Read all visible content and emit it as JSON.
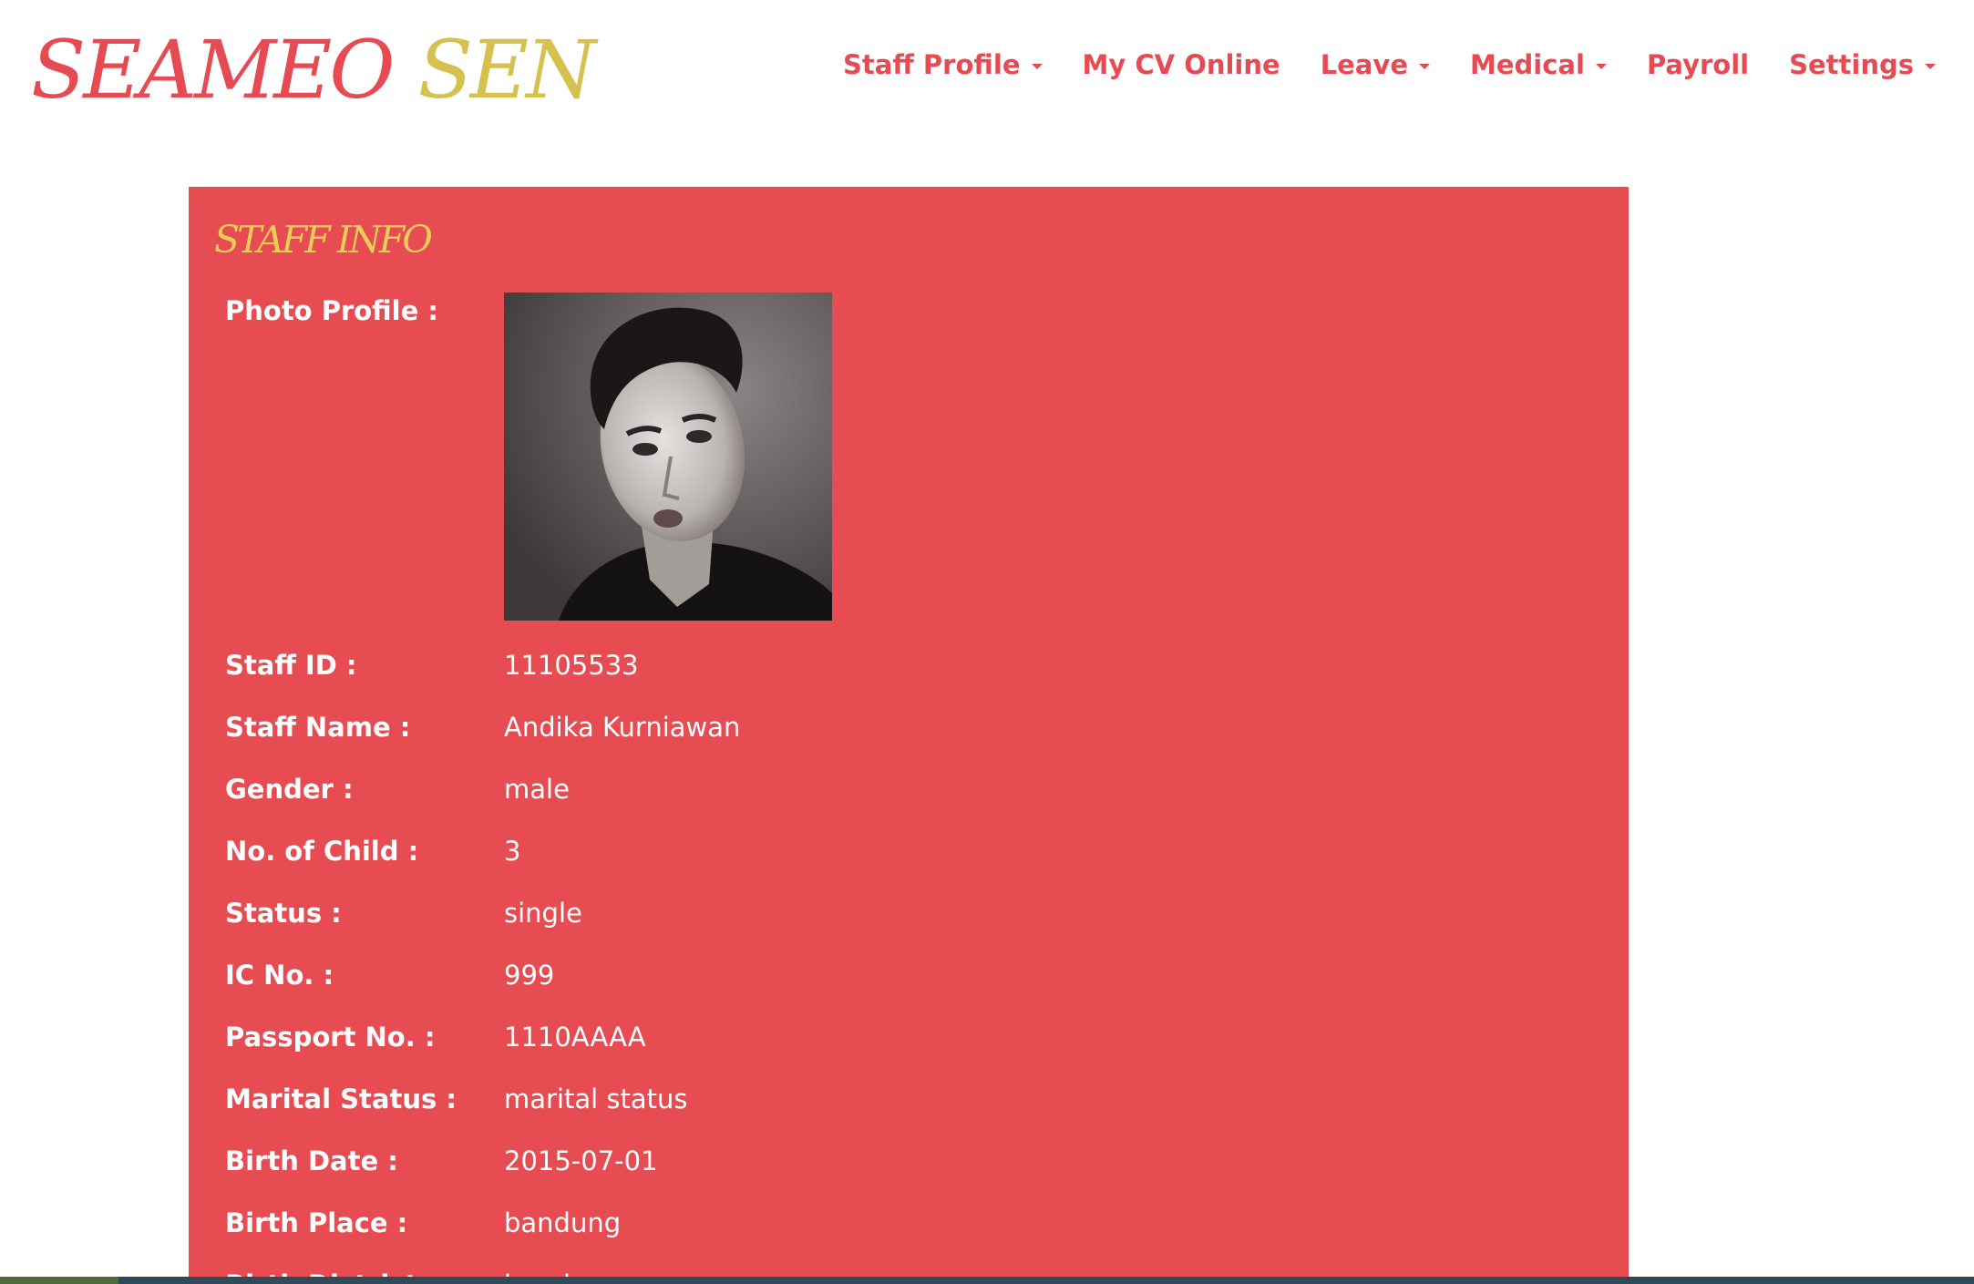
{
  "header": {
    "logo_part1": "SEAMEO",
    "logo_part2": "SEN",
    "nav": [
      {
        "label": "Staff Profile",
        "has_dropdown": true,
        "icon": "caret-down-icon"
      },
      {
        "label": "My CV Online",
        "has_dropdown": false
      },
      {
        "label": "Leave",
        "has_dropdown": true,
        "icon": "caret-down-icon"
      },
      {
        "label": "Medical",
        "has_dropdown": true,
        "icon": "caret-down-icon"
      },
      {
        "label": "Payroll",
        "has_dropdown": false
      },
      {
        "label": "Settings",
        "has_dropdown": true,
        "icon": "caret-down-icon"
      }
    ]
  },
  "panel": {
    "title": "STAFF INFO",
    "photo_label": "Photo Profile :",
    "fields": [
      {
        "label": "Staff ID :",
        "value": "11105533"
      },
      {
        "label": "Staff Name :",
        "value": "Andika Kurniawan"
      },
      {
        "label": "Gender :",
        "value": "male"
      },
      {
        "label": "No. of Child :",
        "value": "3"
      },
      {
        "label": "Status :",
        "value": "single"
      },
      {
        "label": "IC No. :",
        "value": "999"
      },
      {
        "label": "Passport No. :",
        "value": "1110AAAA"
      },
      {
        "label": "Marital Status :",
        "value": "marital status"
      },
      {
        "label": "Birth Date :",
        "value": "2015-07-01"
      },
      {
        "label": "Birth Place :",
        "value": "bandung"
      },
      {
        "label": "Birth District :",
        "value": "bandung"
      }
    ]
  },
  "colors": {
    "brand_red": "#e64a52",
    "brand_gold": "#d6c14e",
    "panel_bg": "#e64c51",
    "panel_title": "#e8cd58"
  }
}
